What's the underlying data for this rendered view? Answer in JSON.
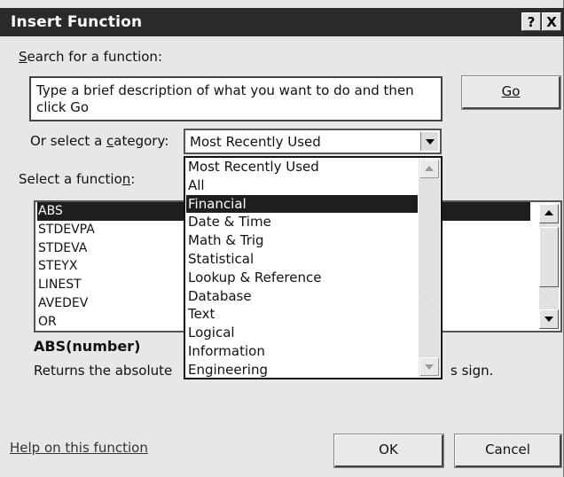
{
  "dialog": {
    "title": "Insert Function",
    "help_button": "?",
    "close_button": "X"
  },
  "search": {
    "label": "Search for a function:",
    "value": "Type a brief description of what you want to do and then click Go",
    "go_label": "Go"
  },
  "category": {
    "label": "Or select a category:",
    "selected": "Most Recently Used",
    "options": [
      "Most Recently Used",
      "All",
      "Financial",
      "Date & Time",
      "Math & Trig",
      "Statistical",
      "Lookup & Reference",
      "Database",
      "Text",
      "Logical",
      "Information",
      "Engineering"
    ],
    "highlighted_index": 2
  },
  "functions": {
    "label": "Select a function:",
    "items": [
      "ABS",
      "STDEVPA",
      "STDEVA",
      "STEYX",
      "LINEST",
      "AVEDEV",
      "OR"
    ],
    "selected_index": 0
  },
  "details": {
    "signature": "ABS(number)",
    "description_start": "Returns the absolute ",
    "description_end": "s sign."
  },
  "footer": {
    "help_link": "Help on this function",
    "ok_label": "OK",
    "cancel_label": "Cancel"
  },
  "icons": {
    "close": "close-icon",
    "dropdown_arrow": "chevron-down-icon",
    "scroll_up": "scroll-up-icon",
    "scroll_down": "scroll-down-icon"
  }
}
